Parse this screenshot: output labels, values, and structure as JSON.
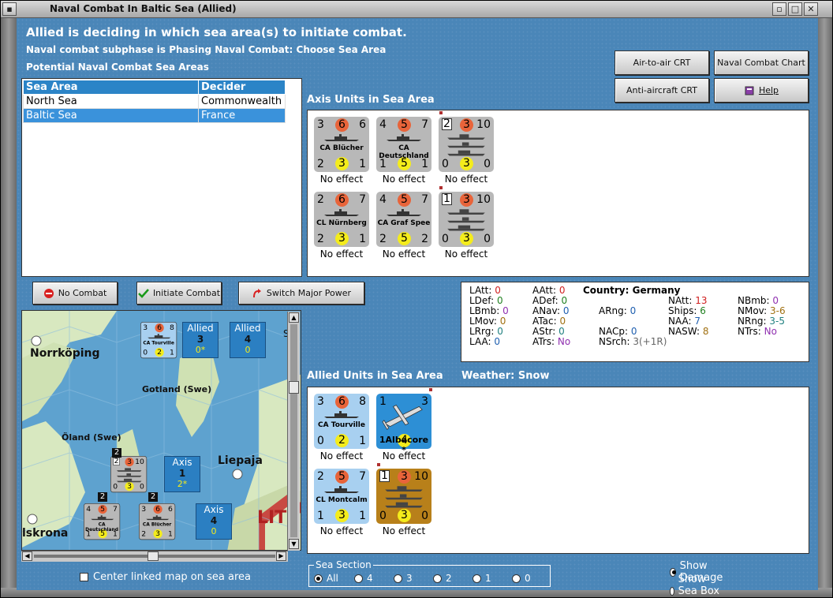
{
  "window": {
    "title": "Naval Combat In Baltic Sea (Allied)"
  },
  "header": {
    "line1": "Allied is deciding in which sea area(s) to initiate combat.",
    "line2": "Naval combat subphase is Phasing Naval Combat: Choose Sea Area",
    "line3": "Potential Naval Combat Sea Areas"
  },
  "buttons": {
    "air_to_air": "Air-to-air CRT",
    "naval_chart": "Naval Combat Chart",
    "anti_aircraft": "Anti-aircraft CRT",
    "help": "Help",
    "no_combat": "No Combat",
    "initiate": "Initiate Combat",
    "switch": "Switch Major Power"
  },
  "sea_table": {
    "headers": [
      "Sea Area",
      "Decider"
    ],
    "rows": [
      [
        "North Sea",
        "Commonwealth"
      ],
      [
        "Baltic Sea",
        "France"
      ]
    ]
  },
  "axis": {
    "title": "Axis Units in Sea Area",
    "units": [
      {
        "tl": "3",
        "tm": "6",
        "tr": "6",
        "bl": "2",
        "bm": "3",
        "br": "1",
        "name": "CA Blücher",
        "caption": "No effect"
      },
      {
        "tl": "4",
        "tm": "5",
        "tr": "7",
        "bl": "1",
        "bm": "5",
        "br": "1",
        "name": "CA Deutschland",
        "caption": "No effect"
      },
      {
        "tl": "2",
        "tm": "3",
        "tr": "10",
        "bl": "0",
        "bm": "3",
        "br": "0",
        "name": "",
        "caption": "No effect"
      },
      {
        "tl": "2",
        "tm": "6",
        "tr": "7",
        "bl": "2",
        "bm": "3",
        "br": "1",
        "name": "CL Nürnberg",
        "caption": "No effect"
      },
      {
        "tl": "4",
        "tm": "5",
        "tr": "7",
        "bl": "2",
        "bm": "5",
        "br": "2",
        "name": "CA Graf Spee",
        "caption": "No effect"
      },
      {
        "tl": "1",
        "tm": "3",
        "tr": "10",
        "bl": "0",
        "bm": "3",
        "br": "0",
        "name": "",
        "caption": "No effect"
      }
    ]
  },
  "allied": {
    "title": "Allied Units in Sea Area",
    "weather_label": "Weather:",
    "weather": "Snow",
    "units": [
      {
        "tl": "3",
        "tm": "6",
        "tr": "8",
        "bl": "0",
        "bm": "2",
        "br": "1",
        "name": "CA Tourville",
        "caption": "No effect"
      },
      {
        "tl": "1",
        "tm": "",
        "tr": "3",
        "bl": "",
        "bm": "4",
        "br": "",
        "name": "1Albacore *",
        "caption": "No effect"
      },
      {
        "tl": "2",
        "tm": "5",
        "tr": "7",
        "bl": "1",
        "bm": "3",
        "br": "1",
        "name": "CL Montcalm",
        "caption": "No effect"
      },
      {
        "tl": "1",
        "tm": "3",
        "tr": "10",
        "bl": "0",
        "bm": "3",
        "br": "0",
        "name": "",
        "caption": "No effect"
      }
    ]
  },
  "stats": {
    "country_label": "Country:",
    "country": "Germany",
    "c1": [
      [
        "LAtt:",
        "0"
      ],
      [
        "LDef:",
        "0"
      ],
      [
        "LBmb:",
        "0"
      ],
      [
        "LMov:",
        "0"
      ],
      [
        "LRrg:",
        "0"
      ],
      [
        "LAA:",
        "0"
      ]
    ],
    "c2": [
      [
        "AAtt:",
        "0"
      ],
      [
        "ADef:",
        "0"
      ],
      [
        "ANav:",
        "0"
      ],
      [
        "ATac:",
        "0"
      ],
      [
        "AStr:",
        "0"
      ],
      [
        "ATrs:",
        "No"
      ]
    ],
    "c3": [
      [
        "ARng:",
        "0"
      ],
      [
        "NACp:",
        "0"
      ],
      [
        "NSrch:",
        "3(+1R)"
      ]
    ],
    "c4": [
      [
        "NAtt:",
        "13"
      ],
      [
        "Ships:",
        "6"
      ],
      [
        "NAA:",
        "7"
      ],
      [
        "NASW:",
        "8"
      ]
    ],
    "c5": [
      [
        "NBmb:",
        "0"
      ],
      [
        "NMov:",
        "3-6"
      ],
      [
        "NRng:",
        "3-5"
      ],
      [
        "NTrs:",
        "No"
      ]
    ]
  },
  "map": {
    "labels": {
      "norrkoping": "Norrköping",
      "gotland": "Gotland (Swe)",
      "oland": "Öland (Swe)",
      "liepaja": "Liepaja",
      "karlskrona": "lskrona",
      "lit": "LIT",
      "s": "S"
    },
    "stacks": [
      {
        "side": "Allied",
        "top": "3",
        "bottom": "0*"
      },
      {
        "side": "Allied",
        "top": "4",
        "bottom": "0"
      },
      {
        "side": "Axis",
        "top": "1",
        "bottom": "2*"
      },
      {
        "side": "Axis",
        "top": "4",
        "bottom": "0"
      }
    ],
    "counters": [
      {
        "tl": "3",
        "tm": "6",
        "tr": "8",
        "bl": "0",
        "bm": "2",
        "br": "1",
        "name": "CA Tourville"
      },
      {
        "tl": "2",
        "tm": "3",
        "tr": "10",
        "bl": "0",
        "bm": "3",
        "br": "0",
        "name": ""
      },
      {
        "tl": "4",
        "tm": "5",
        "tr": "7",
        "bl": "1",
        "bm": "5",
        "br": "1",
        "name": "CA Deutschland"
      },
      {
        "tl": "3",
        "tm": "6",
        "tr": "6",
        "bl": "2",
        "bm": "3",
        "br": "1",
        "name": "CA Blücher"
      }
    ],
    "stack_counts": [
      "2",
      "2",
      "2"
    ]
  },
  "center_map": "Center linked map on sea area",
  "sea_section": {
    "legend": "Sea Section",
    "options": [
      "All",
      "4",
      "3",
      "2",
      "1",
      "0"
    ]
  },
  "display": {
    "show_damage": "Show Damage",
    "show_sections": "Show Sea Box Sections"
  }
}
